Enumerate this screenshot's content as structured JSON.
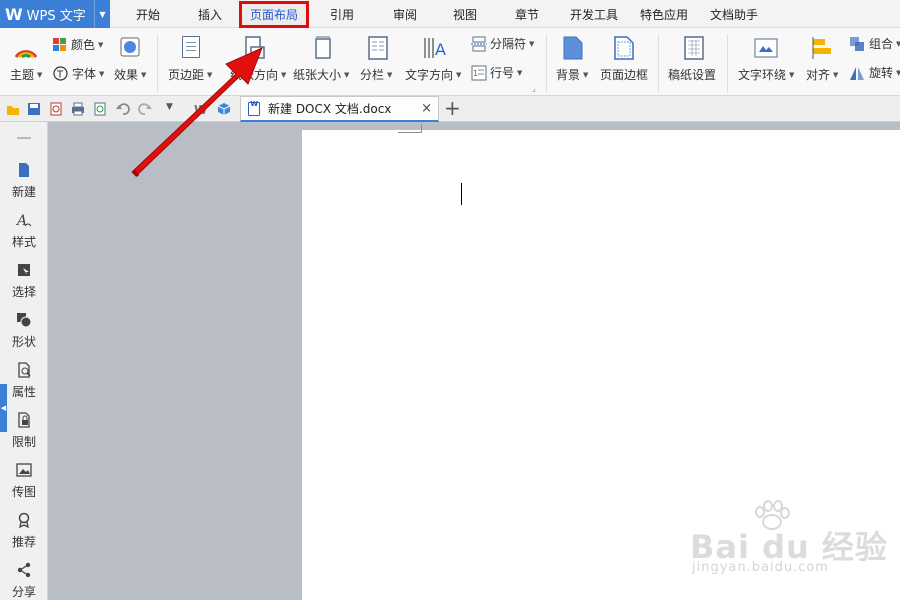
{
  "app": {
    "title": "WPS 文字"
  },
  "menu": {
    "tabs": [
      "开始",
      "插入",
      "页面布局",
      "引用",
      "审阅",
      "视图",
      "章节",
      "开发工具",
      "特色应用",
      "文档助手"
    ],
    "active": "页面布局",
    "highlight_color": "#e00c0c"
  },
  "ribbon": {
    "theme": "主题",
    "color": "颜色",
    "font": "字体",
    "effect": "效果",
    "margins": "页边距",
    "orientation": "纸张方向",
    "paper_size": "纸张大小",
    "columns": "分栏",
    "text_direction": "文字方向",
    "separator": "分隔符",
    "line_number": "行号",
    "background": "背景",
    "page_border": "页面边框",
    "manuscript": "稿纸设置",
    "text_wrap": "文字环绕",
    "align": "对齐",
    "group": "组合",
    "rotate": "旋转"
  },
  "document_tab": {
    "name": "新建 DOCX 文档.docx",
    "close": "×",
    "new_tab": "+"
  },
  "sidebar": {
    "items": [
      {
        "label": "新建",
        "icon": "new-doc-icon"
      },
      {
        "label": "样式",
        "icon": "style-icon"
      },
      {
        "label": "选择",
        "icon": "select-icon"
      },
      {
        "label": "形状",
        "icon": "shape-icon"
      },
      {
        "label": "属性",
        "icon": "properties-icon"
      },
      {
        "label": "限制",
        "icon": "restrict-icon"
      },
      {
        "label": "传图",
        "icon": "upload-image-icon"
      },
      {
        "label": "推荐",
        "icon": "recommend-icon"
      },
      {
        "label": "分享",
        "icon": "share-icon"
      }
    ]
  },
  "watermark": {
    "brand": "Bai du 经验",
    "url": "jingyan.baidu.com"
  },
  "colors": {
    "accent": "#3c7fd6",
    "arrow": "#e20f0f"
  }
}
